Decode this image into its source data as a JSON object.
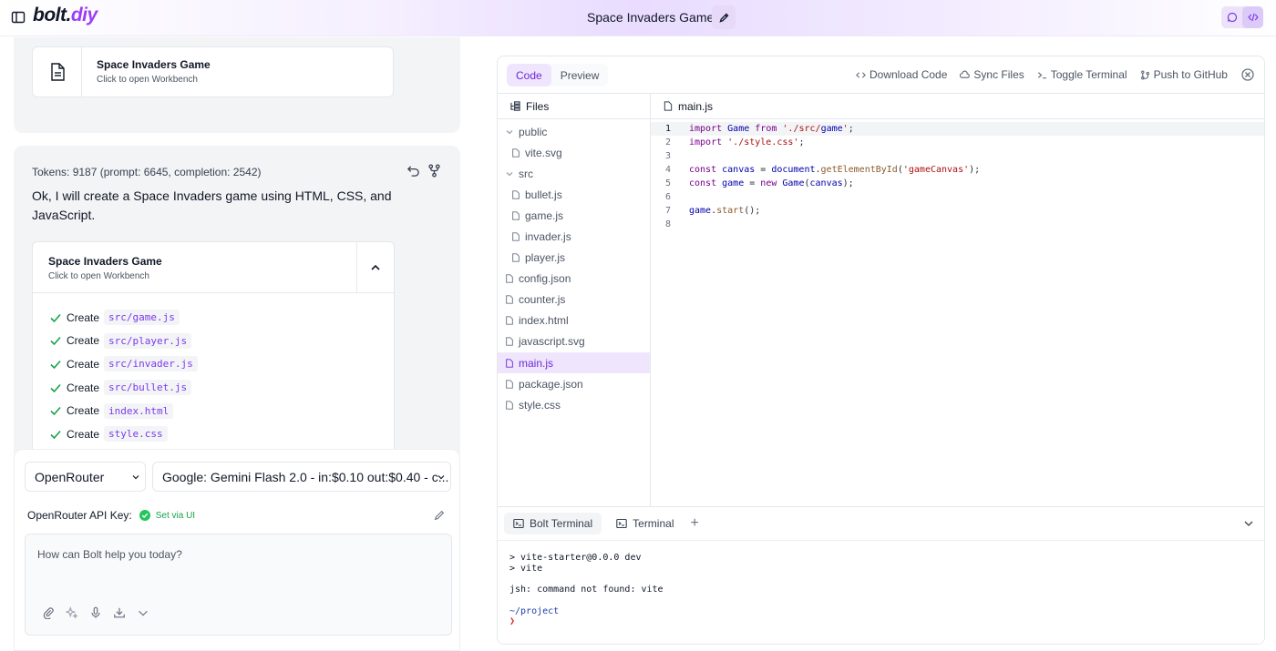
{
  "header": {
    "logo_main": "bolt",
    "logo_dot": ".",
    "logo_suffix": "diy",
    "chat_title": "Space Invaders Game"
  },
  "chat": {
    "artifact_prev": {
      "title": "Space Invaders Game",
      "subtitle": "Click to open Workbench"
    },
    "tokens": "Tokens: 9187 (prompt: 6645, completion: 2542)",
    "message": "Ok, I will create a Space Invaders game using HTML, CSS, and JavaScript.",
    "artifact": {
      "title": "Space Invaders Game",
      "subtitle": "Click to open Workbench",
      "steps": [
        {
          "action": "Create",
          "file": "src/game.js"
        },
        {
          "action": "Create",
          "file": "src/player.js"
        },
        {
          "action": "Create",
          "file": "src/invader.js"
        },
        {
          "action": "Create",
          "file": "src/bullet.js"
        },
        {
          "action": "Create",
          "file": "index.html"
        },
        {
          "action": "Create",
          "file": "style.css"
        }
      ]
    }
  },
  "input": {
    "provider": "OpenRouter",
    "model": "Google: Gemini Flash 2.0 - in:$0.10 out:$0.40 - c...",
    "api_key_label": "OpenRouter API Key:",
    "api_key_status": "Set via UI",
    "placeholder": "How can Bolt help you today?"
  },
  "workbench": {
    "tabs": [
      "Code",
      "Preview"
    ],
    "actions": [
      "Download Code",
      "Sync Files",
      "Toggle Terminal",
      "Push to GitHub"
    ],
    "files_label": "Files",
    "tree": [
      {
        "name": "public",
        "type": "folder",
        "depth": 0
      },
      {
        "name": "vite.svg",
        "type": "file",
        "depth": 1
      },
      {
        "name": "src",
        "type": "folder",
        "depth": 0
      },
      {
        "name": "bullet.js",
        "type": "file",
        "depth": 1
      },
      {
        "name": "game.js",
        "type": "file",
        "depth": 1
      },
      {
        "name": "invader.js",
        "type": "file",
        "depth": 1
      },
      {
        "name": "player.js",
        "type": "file",
        "depth": 1
      },
      {
        "name": "config.json",
        "type": "file",
        "depth": 0
      },
      {
        "name": "counter.js",
        "type": "file",
        "depth": 0
      },
      {
        "name": "index.html",
        "type": "file",
        "depth": 0
      },
      {
        "name": "javascript.svg",
        "type": "file",
        "depth": 0
      },
      {
        "name": "main.js",
        "type": "file",
        "depth": 0,
        "active": true
      },
      {
        "name": "package.json",
        "type": "file",
        "depth": 0
      },
      {
        "name": "style.css",
        "type": "file",
        "depth": 0
      }
    ],
    "open_file": "main.js",
    "code_lines": [
      "import Game from './src/game';",
      "import './style.css';",
      "",
      "const canvas = document.getElementById('gameCanvas');",
      "const game = new Game(canvas);",
      "",
      "game.start();",
      ""
    ],
    "terminal_tabs": [
      "Bolt Terminal",
      "Terminal"
    ],
    "terminal_output": [
      "> vite-starter@0.0.0 dev",
      "> vite",
      "",
      "jsh: command not found: vite",
      "",
      "~/project",
      "❯"
    ]
  },
  "colors": {
    "accent": "#9c3df5",
    "accent_bg": "#efe6fd",
    "success": "#16a34a"
  }
}
